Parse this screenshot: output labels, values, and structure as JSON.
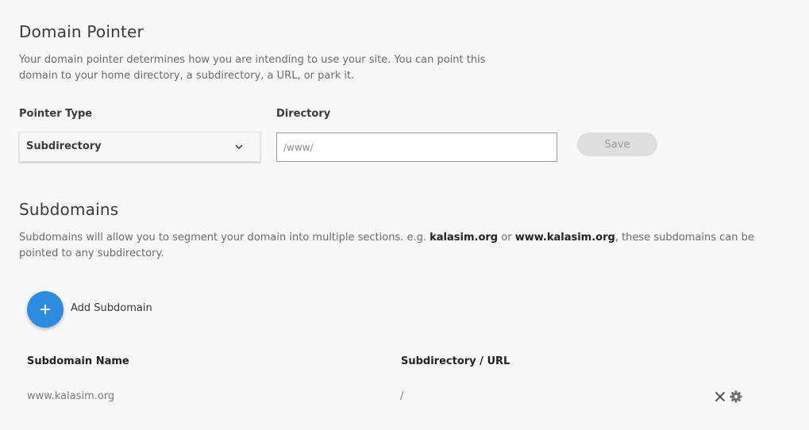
{
  "pointer_section": {
    "title": "Domain Pointer",
    "description_line1": "Your domain pointer determines how you are intending to use your site. You can point this",
    "description_line2": "domain to your home directory, a subdirectory, a URL, or park it."
  },
  "form": {
    "pointer_type_label": "Pointer Type",
    "pointer_type_value": "Subdirectory",
    "directory_label": "Directory",
    "directory_value": "/www/",
    "save_label": "Save"
  },
  "subdomains_section": {
    "title": "Subdomains",
    "description_part1": "Subdomains will allow you to segment your domain into multiple sections. e.g. ",
    "example1": "kalasim.org",
    "description_or": " or ",
    "example2": "www.kalasim.org",
    "description_part2": ", these subdomains can be",
    "description_line2": "pointed to any subdirectory.",
    "add_label": "Add Subdomain"
  },
  "table": {
    "columns": [
      "Subdomain Name",
      "Subdirectory / URL"
    ],
    "rows": [
      {
        "name": "www.kalasim.org",
        "path": "/",
        "icons": [
          "close-icon",
          "gear-icon"
        ]
      }
    ]
  },
  "colors": {
    "accent": "#2f8be0",
    "background": "#f7f7f7",
    "disabled_button": "#dedede"
  }
}
